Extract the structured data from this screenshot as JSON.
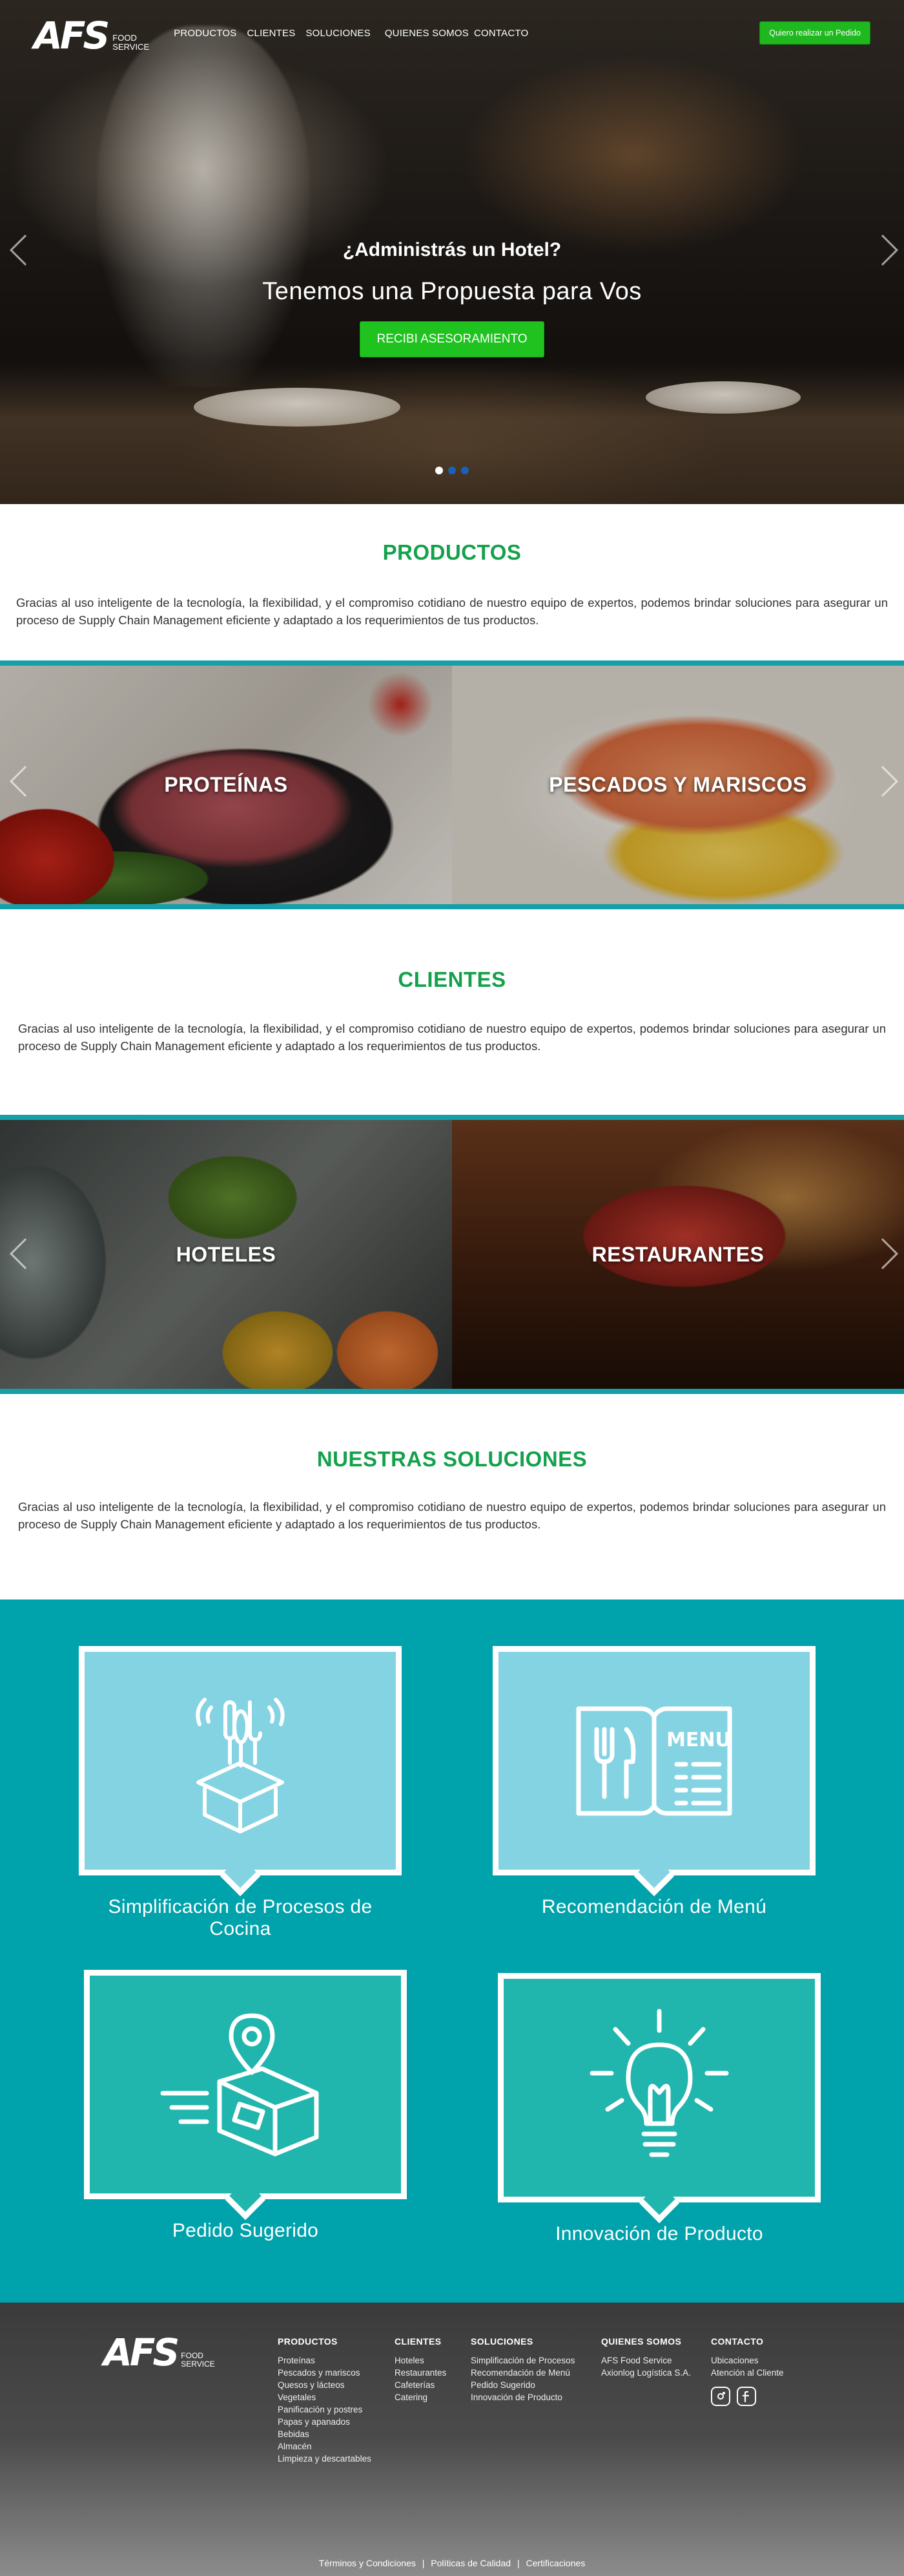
{
  "brand": {
    "logo_mark": "AFS",
    "logo_sub_line1": "FOOD",
    "logo_sub_line2": "SERVICE"
  },
  "nav": {
    "items": [
      "PRODUCTOS",
      "CLIENTES",
      "SOLUCIONES",
      "QUIENES SOMOS",
      "CONTACTO"
    ],
    "order_button": "Quiero realizar un Pedido"
  },
  "hero": {
    "question": "¿Administrás un Hotel?",
    "subtitle": "Tenemos una Propuesta para Vos",
    "button": "RECIBI ASESORAMIENTO",
    "slide_count": 3,
    "active_slide": 1
  },
  "products_section": {
    "title": "PRODUCTOS",
    "text": "Gracias al uso inteligente de la tecnología, la flexibilidad, y el compromiso cotidiano de nuestro equipo de expertos, podemos brindar soluciones para asegurar un proceso de Supply Chain Management eficiente y adaptado a los requerimientos de tus productos.",
    "tiles": [
      "PROTEÍNAS",
      "PESCADOS Y MARISCOS"
    ]
  },
  "clients_section": {
    "title": "CLIENTES",
    "text": "Gracias al uso inteligente de la tecnología, la flexibilidad, y el compromiso cotidiano de nuestro equipo de expertos, podemos brindar soluciones para asegurar un proceso de Supply Chain Management eficiente y adaptado a los requerimientos de tus productos.",
    "tiles": [
      "HOTELES",
      "RESTAURANTES"
    ]
  },
  "solutions_section": {
    "title": "NUESTRAS SOLUCIONES",
    "text": "Gracias al uso inteligente de la tecnología, la flexibilidad, y el compromiso cotidiano de nuestro equipo de expertos, podemos brindar soluciones para asegurar un proceso de Supply Chain Management eficiente y adaptado a los requerimientos de tus productos.",
    "cards": [
      {
        "title": "Simplificación de Procesos de Cocina",
        "icon": "kitchen-tools-box-icon"
      },
      {
        "title": "Recomendación de Menú",
        "icon": "menu-icon",
        "icon_text": "MENU"
      },
      {
        "title": "Pedido Sugerido",
        "icon": "delivery-box-icon"
      },
      {
        "title": "Innovación de Producto",
        "icon": "lightbulb-icon"
      }
    ]
  },
  "footer": {
    "columns": [
      {
        "heading": "PRODUCTOS",
        "items": [
          "Proteínas",
          "Pescados y mariscos",
          "Quesos y lácteos",
          "Vegetales",
          "Panificación y postres",
          "Papas y apanados",
          "Bebidas",
          "Almacén",
          "Limpieza y descartables"
        ]
      },
      {
        "heading": "CLIENTES",
        "items": [
          "Hoteles",
          "Restaurantes",
          "Cafeterías",
          "Catering"
        ]
      },
      {
        "heading": "SOLUCIONES",
        "items": [
          "Simplificación de Procesos",
          "Recomendación de Menú",
          "Pedido Sugerido",
          "Innovación de Producto"
        ]
      },
      {
        "heading": "QUIENES SOMOS",
        "items": [
          "AFS Food Service",
          "Axionlog Logística S.A."
        ]
      },
      {
        "heading": "CONTACTO",
        "items": [
          "Ubicaciones",
          "Atención al Cliente"
        ]
      }
    ],
    "social": [
      "instagram-icon",
      "facebook-icon"
    ],
    "legal": [
      "Términos y Condiciones",
      "Políticas de Calidad",
      "Certificaciones"
    ],
    "legal_separator": "|"
  },
  "colors": {
    "accent_green": "#14a14b",
    "button_green": "#1fc21f",
    "teal": "#00a2ab",
    "band_teal": "#15a0a9",
    "card_light": "#84d3e3",
    "card_teal": "#20b5ad"
  }
}
